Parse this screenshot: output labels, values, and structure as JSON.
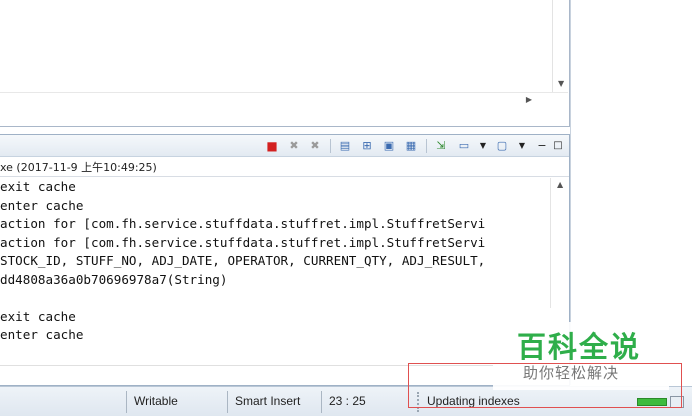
{
  "console": {
    "header": "xe (2017-11-9 上午10:49:25)",
    "lines": [
      "exit cache",
      "enter cache",
      "action for [com.fh.service.stuffdata.stuffret.impl.StuffretServi",
      "action for [com.fh.service.stuffdata.stuffret.impl.StuffretServi",
      "STOCK_ID, STUFF_NO, ADJ_DATE, OPERATOR, CURRENT_QTY, ADJ_RESULT,",
      "dd4808a36a0b70696978a7(String)",
      "",
      "exit cache",
      "enter cache"
    ],
    "toolbar_icons": [
      "terminate-icon",
      "remove-launch-icon",
      "remove-all-terminated-icon",
      "clear-console-icon",
      "scroll-lock-icon",
      "word-wrap-icon",
      "show-when-output-icon",
      "pin-console-icon",
      "display-console-icon",
      "dropdown-icon",
      "open-console-icon",
      "dropdown-icon",
      "minimize-icon",
      "maximize-icon"
    ]
  },
  "watermark": {
    "title": "百科全说",
    "subtitle": "助你轻松解决"
  },
  "statusbar": {
    "writable": "Writable",
    "insert_mode": "Smart Insert",
    "position": "23 : 25",
    "progress_text": "Updating indexes",
    "progress_color": "#3dbb3d"
  }
}
